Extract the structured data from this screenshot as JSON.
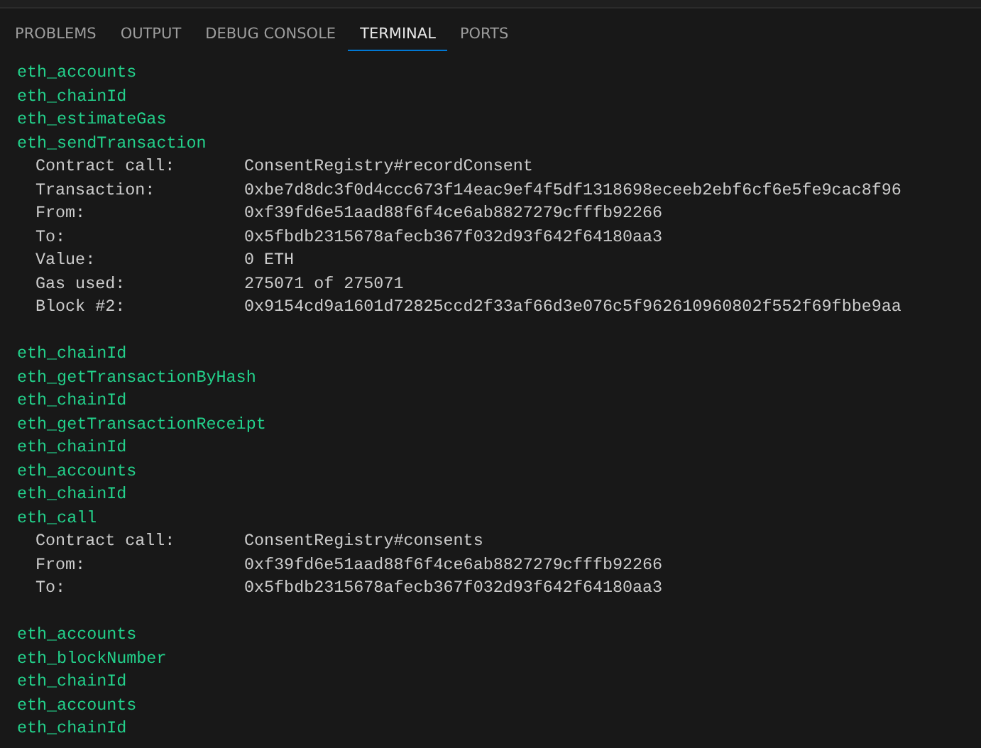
{
  "tabs": [
    {
      "label": "PROBLEMS",
      "selected": false
    },
    {
      "label": "OUTPUT",
      "selected": false
    },
    {
      "label": "DEBUG CONSOLE",
      "selected": false
    },
    {
      "label": "TERMINAL",
      "selected": true
    },
    {
      "label": "PORTS",
      "selected": false
    }
  ],
  "terminal": [
    {
      "method": "eth_accounts"
    },
    {
      "method": "eth_chainId"
    },
    {
      "method": "eth_estimateGas"
    },
    {
      "method": "eth_sendTransaction",
      "details": [
        {
          "label": "Contract call:",
          "value": "ConsentRegistry#recordConsent"
        },
        {
          "label": "Transaction:",
          "value": "0xbe7d8dc3f0d4ccc673f14eac9ef4f5df1318698eceeb2ebf6cf6e5fe9cac8f96"
        },
        {
          "label": "From:",
          "value": "0xf39fd6e51aad88f6f4ce6ab8827279cfffb92266"
        },
        {
          "label": "To:",
          "value": "0x5fbdb2315678afecb367f032d93f642f64180aa3"
        },
        {
          "label": "Value:",
          "value": "0 ETH"
        },
        {
          "label": "Gas used:",
          "value": "275071 of 275071"
        },
        {
          "label": "Block #2:",
          "value": "0x9154cd9a1601d72825ccd2f33af66d3e076c5f962610960802f552f69fbbe9aa"
        }
      ]
    },
    {
      "method": "eth_chainId"
    },
    {
      "method": "eth_getTransactionByHash"
    },
    {
      "method": "eth_chainId"
    },
    {
      "method": "eth_getTransactionReceipt"
    },
    {
      "method": "eth_chainId"
    },
    {
      "method": "eth_accounts"
    },
    {
      "method": "eth_chainId"
    },
    {
      "method": "eth_call",
      "details": [
        {
          "label": "Contract call:",
          "value": "ConsentRegistry#consents"
        },
        {
          "label": "From:",
          "value": "0xf39fd6e51aad88f6f4ce6ab8827279cfffb92266"
        },
        {
          "label": "To:",
          "value": "0x5fbdb2315678afecb367f032d93f642f64180aa3"
        }
      ]
    },
    {
      "method": "eth_accounts"
    },
    {
      "method": "eth_blockNumber"
    },
    {
      "method": "eth_chainId"
    },
    {
      "method": "eth_accounts"
    },
    {
      "method": "eth_chainId"
    }
  ]
}
